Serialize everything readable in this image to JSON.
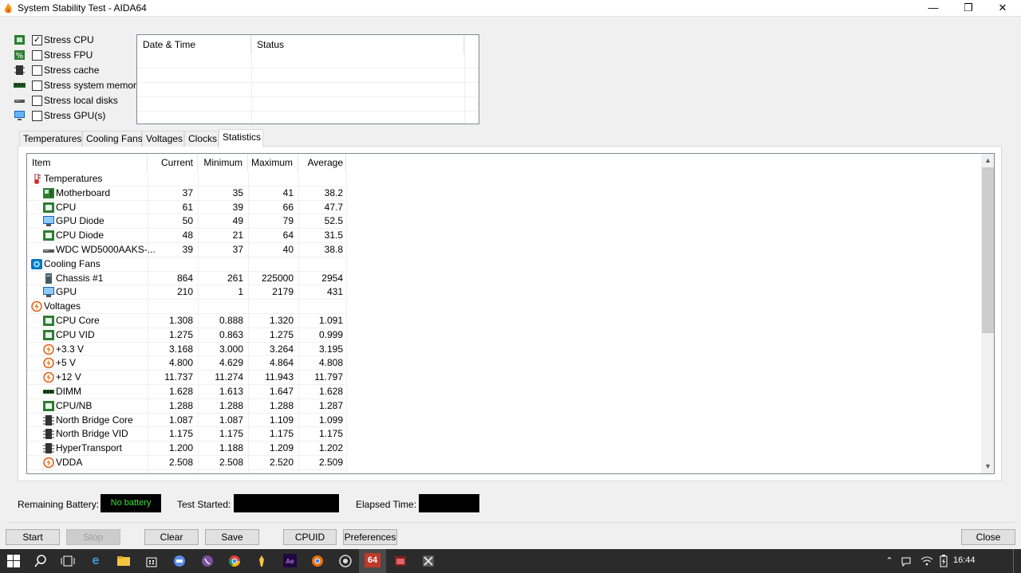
{
  "window": {
    "title": "System Stability Test - AIDA64",
    "minimize": "—",
    "maximize": "❐",
    "close": "✕"
  },
  "stress": [
    {
      "label": "Stress CPU",
      "checked": true,
      "icon": "cpu-chip-icon"
    },
    {
      "label": "Stress FPU",
      "checked": false,
      "icon": "fpu-icon"
    },
    {
      "label": "Stress cache",
      "checked": false,
      "icon": "cache-icon"
    },
    {
      "label": "Stress system memory",
      "checked": false,
      "icon": "memory-icon"
    },
    {
      "label": "Stress local disks",
      "checked": false,
      "icon": "disk-icon"
    },
    {
      "label": "Stress GPU(s)",
      "checked": false,
      "icon": "gpu-monitor-icon"
    }
  ],
  "log": {
    "col_datetime": "Date & Time",
    "col_status": "Status"
  },
  "tabs": [
    "Temperatures",
    "Cooling Fans",
    "Voltages",
    "Clocks",
    "Statistics"
  ],
  "active_tab": "Statistics",
  "grid": {
    "headers": {
      "item": "Item",
      "current": "Current",
      "minimum": "Minimum",
      "maximum": "Maximum",
      "average": "Average"
    },
    "rows": [
      {
        "group": true,
        "label": "Temperatures",
        "icon": "thermometer-icon"
      },
      {
        "label": "Motherboard",
        "icon": "motherboard-icon",
        "current": "37",
        "min": "35",
        "max": "41",
        "avg": "38.2"
      },
      {
        "label": "CPU",
        "icon": "cpu-chip-icon",
        "current": "61",
        "min": "39",
        "max": "66",
        "avg": "47.7"
      },
      {
        "label": "GPU Diode",
        "icon": "gpu-monitor-icon",
        "current": "50",
        "min": "49",
        "max": "79",
        "avg": "52.5"
      },
      {
        "label": "CPU Diode",
        "icon": "cpu-chip-icon",
        "current": "48",
        "min": "21",
        "max": "64",
        "avg": "31.5"
      },
      {
        "label": "WDC WD5000AAKS-...",
        "icon": "disk-icon",
        "current": "39",
        "min": "37",
        "max": "40",
        "avg": "38.8"
      },
      {
        "group": true,
        "label": "Cooling Fans",
        "icon": "fan-icon"
      },
      {
        "label": "Chassis #1",
        "icon": "chassis-icon",
        "current": "864",
        "min": "261",
        "max": "225000",
        "avg": "2954"
      },
      {
        "label": "GPU",
        "icon": "gpu-monitor-icon",
        "current": "210",
        "min": "1",
        "max": "2179",
        "avg": "431"
      },
      {
        "group": true,
        "label": "Voltages",
        "icon": "voltage-icon"
      },
      {
        "label": "CPU Core",
        "icon": "cpu-chip-icon",
        "current": "1.308",
        "min": "0.888",
        "max": "1.320",
        "avg": "1.091"
      },
      {
        "label": "CPU VID",
        "icon": "cpu-chip-icon",
        "current": "1.275",
        "min": "0.863",
        "max": "1.275",
        "avg": "0.999"
      },
      {
        "label": "+3.3 V",
        "icon": "voltage-icon",
        "current": "3.168",
        "min": "3.000",
        "max": "3.264",
        "avg": "3.195"
      },
      {
        "label": "+5 V",
        "icon": "voltage-icon",
        "current": "4.800",
        "min": "4.629",
        "max": "4.864",
        "avg": "4.808"
      },
      {
        "label": "+12 V",
        "icon": "voltage-icon",
        "current": "11.737",
        "min": "11.274",
        "max": "11.943",
        "avg": "11.797"
      },
      {
        "label": "DIMM",
        "icon": "memory-icon",
        "current": "1.628",
        "min": "1.613",
        "max": "1.647",
        "avg": "1.628"
      },
      {
        "label": "CPU/NB",
        "icon": "cpu-chip-icon",
        "current": "1.288",
        "min": "1.288",
        "max": "1.288",
        "avg": "1.287"
      },
      {
        "label": "North Bridge Core",
        "icon": "chipset-icon",
        "current": "1.087",
        "min": "1.087",
        "max": "1.109",
        "avg": "1.099"
      },
      {
        "label": "North Bridge VID",
        "icon": "chipset-icon",
        "current": "1.175",
        "min": "1.175",
        "max": "1.175",
        "avg": "1.175"
      },
      {
        "label": "HyperTransport",
        "icon": "chipset-icon",
        "current": "1.200",
        "min": "1.188",
        "max": "1.209",
        "avg": "1.202"
      },
      {
        "label": "VDDA",
        "icon": "voltage-icon",
        "current": "2.508",
        "min": "2.508",
        "max": "2.520",
        "avg": "2.509"
      }
    ]
  },
  "status": {
    "battery_label": "Remaining Battery:",
    "battery_value": "No battery",
    "started_label": "Test Started:",
    "elapsed_label": "Elapsed Time:"
  },
  "buttons": {
    "start": "Start",
    "stop": "Stop",
    "clear": "Clear",
    "save": "Save",
    "cpuid": "CPUID",
    "preferences": "Preferences",
    "close": "Close"
  },
  "taskbar": {
    "clock": "16:44",
    "aida_label": "64"
  },
  "colors": {
    "battery_text": "#3be13b",
    "status_box_bg": "#000000",
    "taskbar_bg": "#2b2b2b"
  }
}
